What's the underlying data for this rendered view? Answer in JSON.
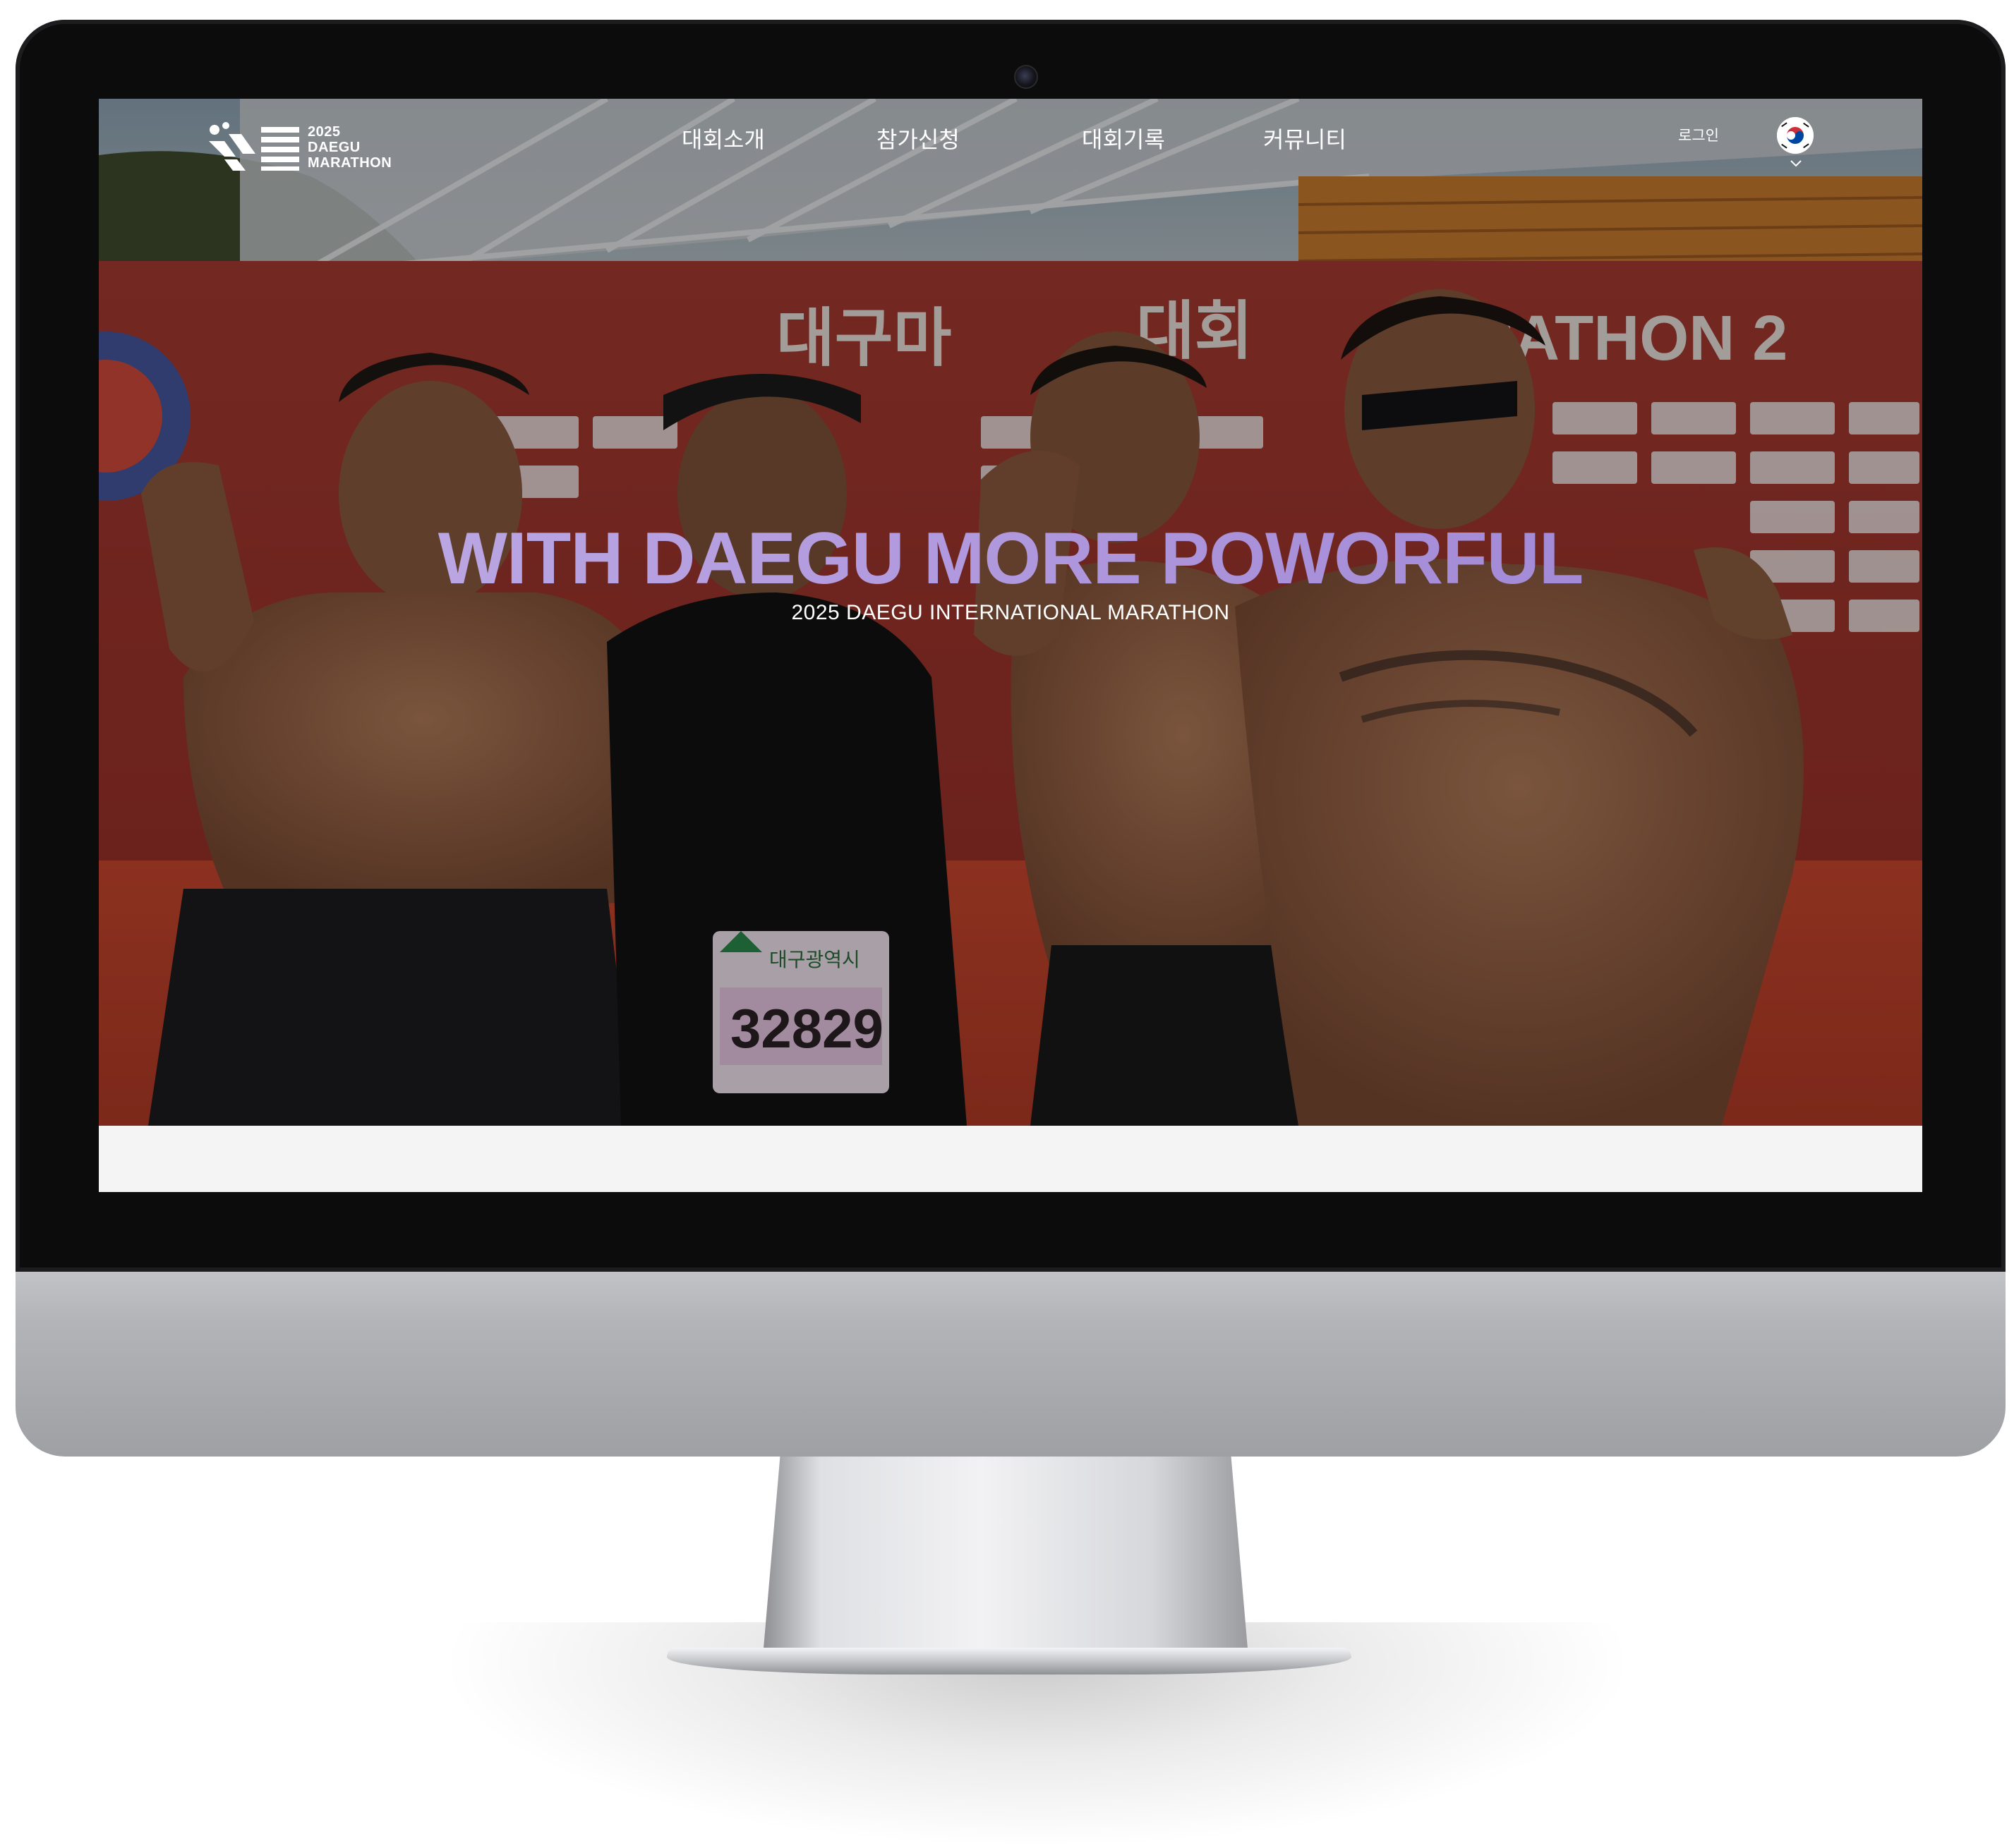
{
  "site": {
    "logo": {
      "line1": "2025",
      "line2": "DAEGU",
      "line3": "MARATHON"
    },
    "nav": {
      "items": [
        {
          "label": "대회소개"
        },
        {
          "label": "참가신청"
        },
        {
          "label": "대회기록"
        },
        {
          "label": "커뮤니티"
        }
      ],
      "login_label": "로그인",
      "language_flag": "korea-flag-icon"
    },
    "hero": {
      "title": "WITH DAEGU MORE POWORFUL",
      "subtitle": "2025 DAEGU INTERNATIONAL MARATHON",
      "backdrop_text": "MARATHON 2",
      "backdrop_text_korean": "대구마 대회",
      "bib_number": "32829",
      "bib_label": "대구광역시"
    }
  },
  "colors": {
    "title_gradient_start": "#c0aee6",
    "title_gradient_end": "#9c82d3",
    "backdrop_red": "#b03a30",
    "bezel": "#0c0c0d"
  }
}
